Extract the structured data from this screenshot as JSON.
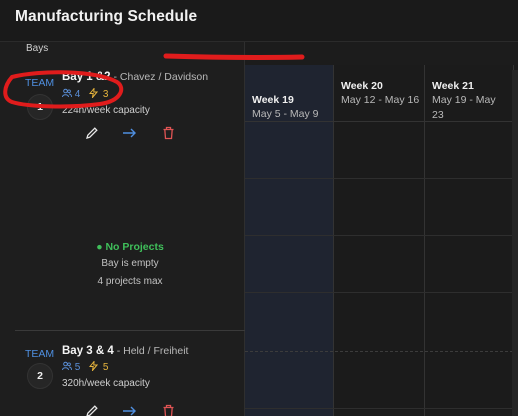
{
  "app": {
    "title": "Manufacturing Schedule"
  },
  "sidebar": {
    "bays_label": "Bays"
  },
  "bays": [
    {
      "team_label": "TEAM",
      "number": "1",
      "name": "Bay 1 &2",
      "leads": " - Chavez / Davidson",
      "people_count": "4",
      "bolt_count": "3",
      "capacity": "224h/week capacity",
      "status": "No Projects",
      "empty_text": "Bay is empty",
      "max_text": "4 projects max"
    },
    {
      "team_label": "TEAM",
      "number": "2",
      "name": "Bay 3 & 4",
      "leads": " - Held / Freiheit",
      "people_count": "5",
      "bolt_count": "5",
      "capacity": "320h/week capacity"
    }
  ],
  "weeks": [
    {
      "title": "Week 19",
      "range": "May 5 - May 9",
      "current": true
    },
    {
      "title": "Week 20",
      "range": "May 12 - May 16",
      "current": false
    },
    {
      "title": "Week 21",
      "range": "May 19 - May 23",
      "current": false
    }
  ],
  "icons": {
    "people": "users-icon",
    "bolt": "bolt-icon",
    "edit": "pencil-icon",
    "move": "arrow-right-icon",
    "delete": "trash-icon"
  },
  "colors": {
    "team_blue": "#4f8fe0",
    "status_green": "#3fbf5a",
    "bolt_yellow": "#e6b43c",
    "delete_red": "#e05454",
    "annotation_red": "#e01c1c"
  }
}
